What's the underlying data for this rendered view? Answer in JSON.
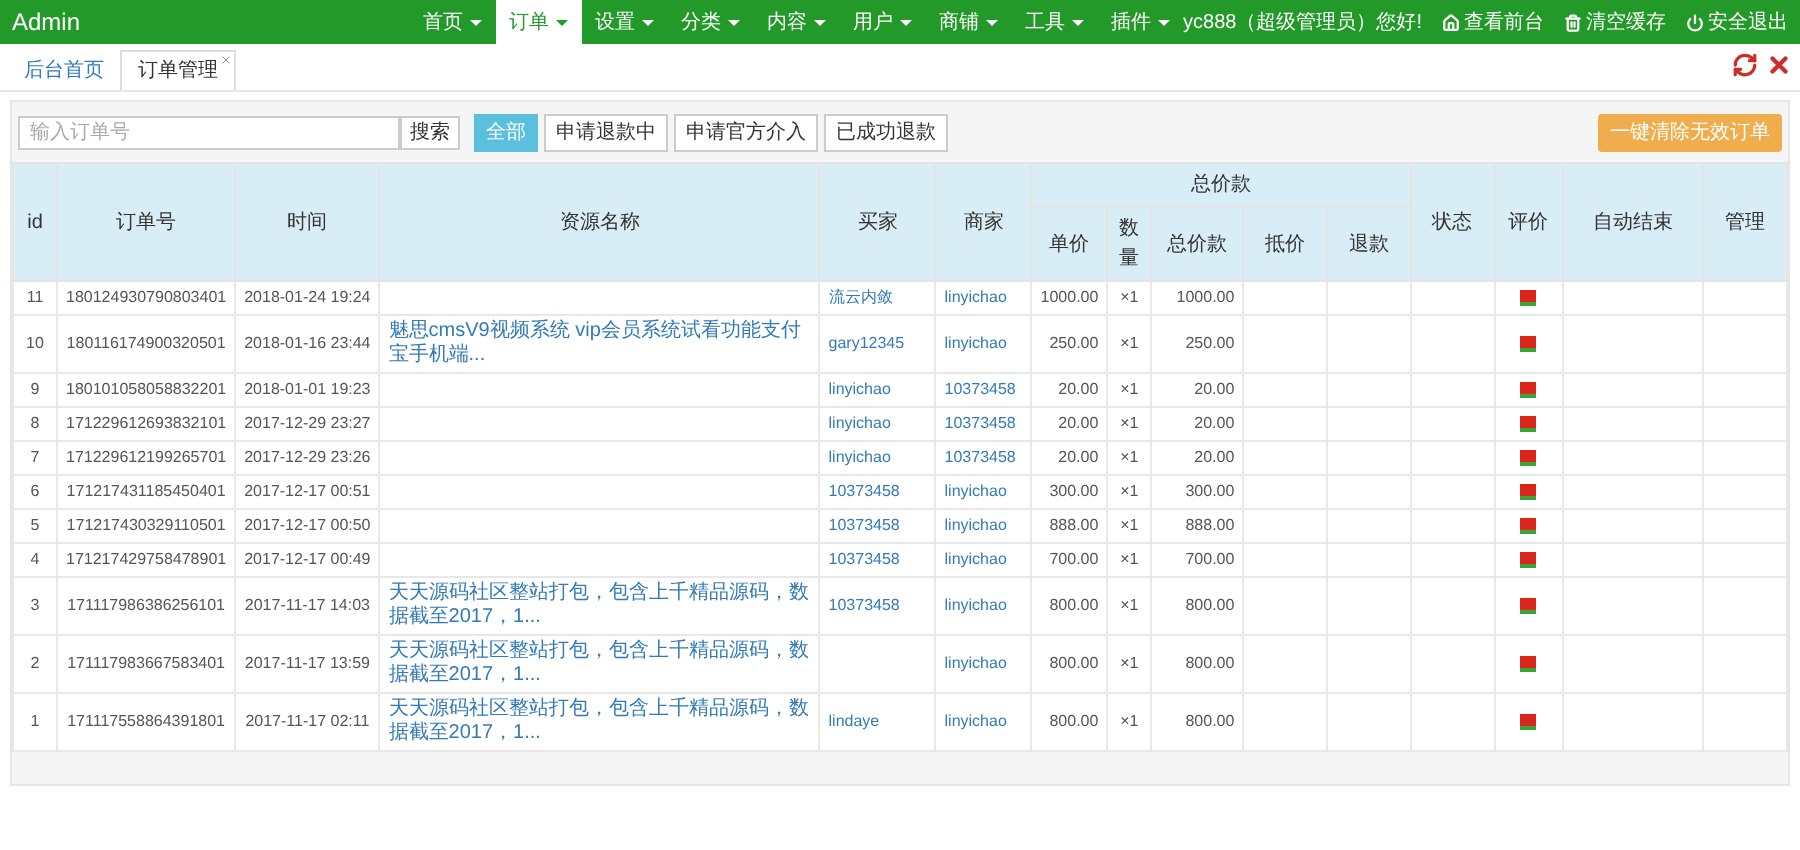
{
  "brand": "Admin",
  "nav": [
    {
      "label": "首页",
      "selected": false
    },
    {
      "label": "订单",
      "selected": true
    },
    {
      "label": "设置",
      "selected": false
    },
    {
      "label": "分类",
      "selected": false
    },
    {
      "label": "内容",
      "selected": false
    },
    {
      "label": "用户",
      "selected": false
    },
    {
      "label": "商铺",
      "selected": false
    },
    {
      "label": "工具",
      "selected": false
    },
    {
      "label": "插件",
      "selected": false
    }
  ],
  "greeting": "yc888（超级管理员）您好!",
  "top_links": [
    {
      "kind": "home",
      "label": "查看前台"
    },
    {
      "kind": "cache",
      "label": "清空缓存"
    },
    {
      "kind": "logout",
      "label": "安全退出"
    }
  ],
  "tabs": [
    {
      "label": "后台首页",
      "selected": false,
      "closable": false
    },
    {
      "label": "订单管理",
      "selected": true,
      "closable": true
    }
  ],
  "search": {
    "placeholder": "输入订单号",
    "button": "搜索"
  },
  "filters": [
    {
      "label": "全部",
      "selected": true
    },
    {
      "label": "申请退款中",
      "selected": false
    },
    {
      "label": "申请官方介入",
      "selected": false
    },
    {
      "label": "已成功退款",
      "selected": false
    }
  ],
  "clear_button": "一键清除无效订单",
  "table": {
    "columns": [
      "id",
      "订单号",
      "时间",
      "资源名称",
      "买家",
      "商家"
    ],
    "price_group": {
      "label": "总价款",
      "columns": [
        "单价",
        "数量",
        "总价款",
        "抵价",
        "退款"
      ]
    },
    "tail_columns": [
      "状态",
      "评价",
      "自动结束",
      "管理"
    ],
    "rows": [
      {
        "id": "11",
        "order_no": "180124930790803401",
        "time": "2018-01-24 19:24",
        "buyer": "流云内敛",
        "seller": "linyichao",
        "unit_price": "1000.00",
        "quantity": "×1",
        "total": "1000.00"
      },
      {
        "id": "10",
        "order_no": "180116174900320501",
        "time": "2018-01-16 23:44",
        "product": "魅思cmsV9视频系统 vip会员系统试看功能支付宝手机端...",
        "buyer": "gary12345",
        "seller": "linyichao",
        "unit_price": "250.00",
        "quantity": "×1",
        "total": "250.00"
      },
      {
        "id": "9",
        "order_no": "180101058058832201",
        "time": "2018-01-01 19:23",
        "buyer": "linyichao",
        "seller": "10373458",
        "unit_price": "20.00",
        "quantity": "×1",
        "total": "20.00"
      },
      {
        "id": "8",
        "order_no": "171229612693832101",
        "time": "2017-12-29 23:27",
        "buyer": "linyichao",
        "seller": "10373458",
        "unit_price": "20.00",
        "quantity": "×1",
        "total": "20.00"
      },
      {
        "id": "7",
        "order_no": "171229612199265701",
        "time": "2017-12-29 23:26",
        "buyer": "linyichao",
        "seller": "10373458",
        "unit_price": "20.00",
        "quantity": "×1",
        "total": "20.00"
      },
      {
        "id": "6",
        "order_no": "171217431185450401",
        "time": "2017-12-17 00:51",
        "buyer": "10373458",
        "seller": "linyichao",
        "unit_price": "300.00",
        "quantity": "×1",
        "total": "300.00"
      },
      {
        "id": "5",
        "order_no": "171217430329110501",
        "time": "2017-12-17 00:50",
        "buyer": "10373458",
        "seller": "linyichao",
        "unit_price": "888.00",
        "quantity": "×1",
        "total": "888.00"
      },
      {
        "id": "4",
        "order_no": "171217429758478901",
        "time": "2017-12-17 00:49",
        "buyer": "10373458",
        "seller": "linyichao",
        "unit_price": "700.00",
        "quantity": "×1",
        "total": "700.00"
      },
      {
        "id": "3",
        "order_no": "171117986386256101",
        "time": "2017-11-17 14:03",
        "product": "天天源码社区整站打包，包含上千精品源码，数据截至2017，1...",
        "buyer": "10373458",
        "seller": "linyichao",
        "unit_price": "800.00",
        "quantity": "×1",
        "total": "800.00"
      },
      {
        "id": "2",
        "order_no": "171117983667583401",
        "time": "2017-11-17 13:59",
        "product": "天天源码社区整站打包，包含上千精品源码，数据截至2017，1...",
        "seller": "linyichao",
        "unit_price": "800.00",
        "quantity": "×1",
        "total": "800.00"
      },
      {
        "id": "1",
        "order_no": "171117558864391801",
        "time": "2017-11-17 02:11",
        "product": "天天源码社区整站打包，包含上千精品源码，数据截至2017，1...",
        "buyer": "lindaye",
        "seller": "linyichao",
        "unit_price": "800.00",
        "quantity": "×1",
        "total": "800.00"
      }
    ]
  }
}
